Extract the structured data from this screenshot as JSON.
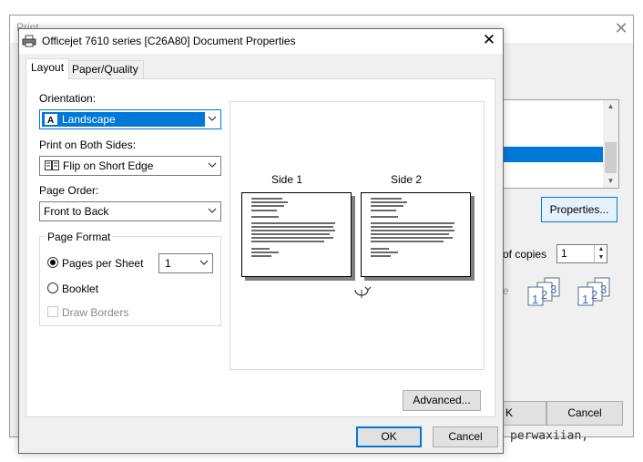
{
  "print_dialog": {
    "title": "Print",
    "close_glyph": "✕",
    "properties_label": "Properties...",
    "copies_label": "of copies",
    "copies_value": "1",
    "collate_label": "e",
    "ok_label": "K",
    "cancel_label": "Cancel",
    "background_text": "perwaxiian,"
  },
  "props_dialog": {
    "title": "Officejet 7610 series [C26A80] Document Properties",
    "close_glyph": "✕",
    "tabs": [
      {
        "label": "Layout",
        "active": true
      },
      {
        "label": "Paper/Quality",
        "active": false
      }
    ],
    "orientation": {
      "label": "Orientation:",
      "value": "Landscape",
      "icon": "landscape-page-icon"
    },
    "both_sides": {
      "label": "Print on Both Sides:",
      "value": "Flip on Short Edge",
      "icon": "book-flip-icon"
    },
    "page_order": {
      "label": "Page Order:",
      "value": "Front to Back"
    },
    "page_format": {
      "title": "Page Format",
      "pages_per_sheet_label": "Pages per Sheet",
      "pages_per_sheet_value": "1",
      "booklet_label": "Booklet",
      "draw_borders_label": "Draw Borders",
      "selected": "pages_per_sheet"
    },
    "preview": {
      "side1_label": "Side 1",
      "side2_label": "Side 2"
    },
    "advanced_label": "Advanced...",
    "ok_label": "OK",
    "cancel_label": "Cancel"
  },
  "colors": {
    "accent": "#0078d7",
    "face": "#f0f0f0",
    "button": "#e1e1e1"
  }
}
